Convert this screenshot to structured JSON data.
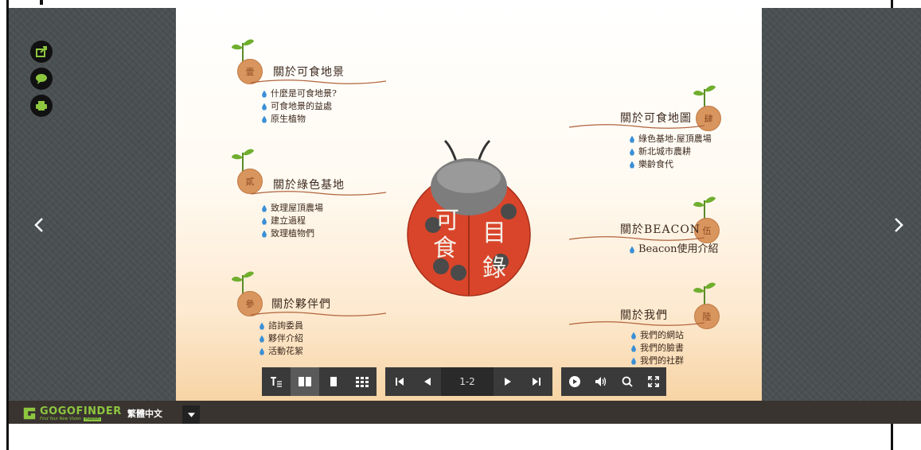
{
  "viewer": {
    "side_tools": [
      {
        "name": "share-icon"
      },
      {
        "name": "comment-icon"
      },
      {
        "name": "print-icon"
      }
    ],
    "nav": {
      "prev": "chevron-left-icon",
      "next": "chevron-right-icon"
    }
  },
  "page": {
    "sections": [
      {
        "seal": "壹",
        "title": "關於可食地景",
        "items": [
          "什麼是可食地景?",
          "可食地景的益處",
          "原生植物"
        ]
      },
      {
        "seal": "貳",
        "title": "關於綠色基地",
        "items": [
          "致理屋頂農場",
          "建立過程",
          "致理植物們"
        ]
      },
      {
        "seal": "參",
        "title": "關於夥伴們",
        "items": [
          "諮詢委員",
          "夥伴介紹",
          "活動花絮"
        ]
      },
      {
        "seal": "肆",
        "title": "關於可食地圖",
        "items": [
          "綠色基地-屋頂農場",
          "新北城市農耕",
          "樂齡食代"
        ]
      },
      {
        "seal": "伍",
        "title": "關於BEACON",
        "items": [
          "Beacon使用介紹"
        ]
      },
      {
        "seal": "陸",
        "title": "關於我們",
        "items": [
          "我們的網站",
          "我們的臉書",
          "我們的社群"
        ]
      }
    ],
    "ladybug": {
      "left_text": [
        "可",
        "食"
      ],
      "right_text": [
        "目",
        "錄"
      ]
    }
  },
  "toolbar": {
    "page_indicator": "1-2"
  },
  "footer": {
    "brand": "GOGOFINDER",
    "tagline": "Find Your New Vision",
    "badge": "Publish",
    "language": "繁體中文"
  },
  "colors": {
    "accent_orange": "#d9955e",
    "ladybug_red": "#d9452a",
    "drop_blue": "#3a8fd6",
    "brand_green": "#8dc63f"
  }
}
